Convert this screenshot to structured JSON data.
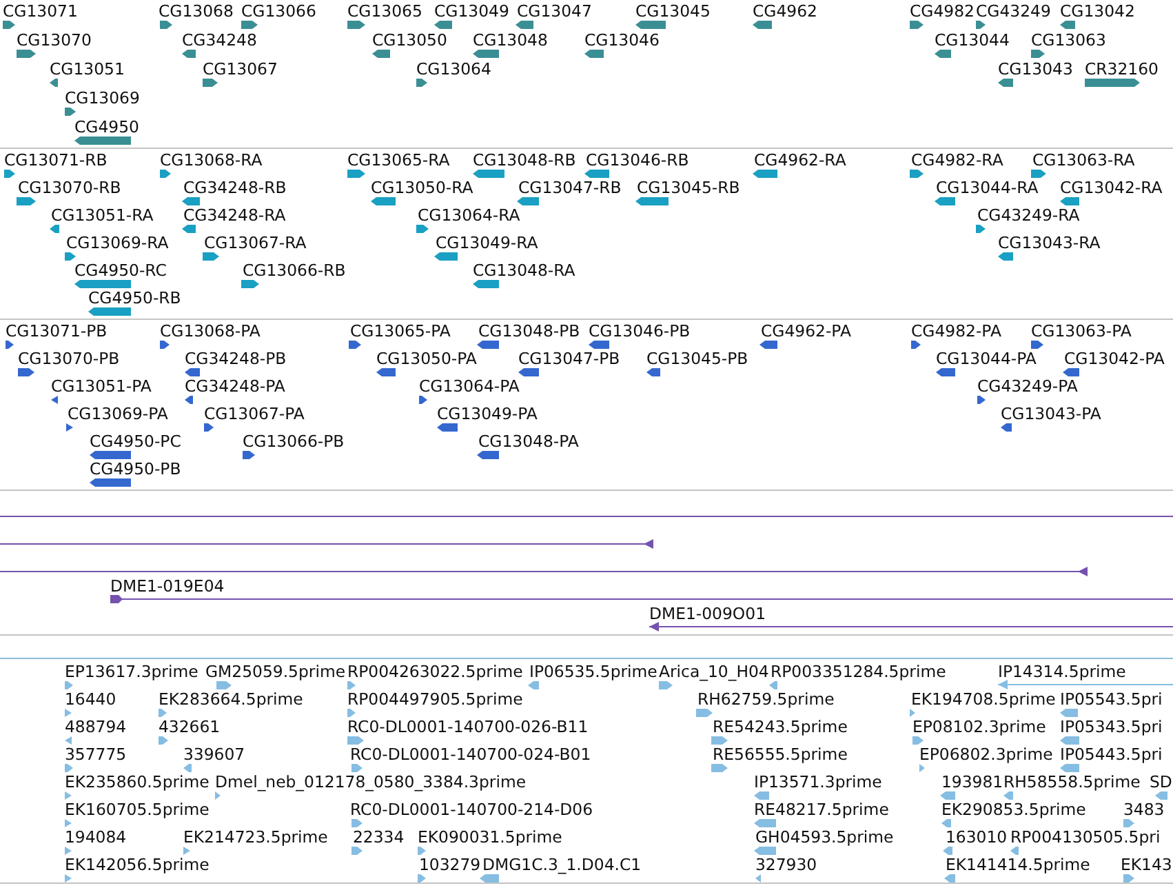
{
  "tracks": [
    {
      "kind": "arrows",
      "color": "#3a8f94",
      "lanes": [
        {
          "features": [
            {
              "label": "CG13071",
              "reverse": false
            },
            {
              "label": "CG13068",
              "reverse": false
            },
            {
              "label": "CG13066",
              "reverse": false
            },
            {
              "label": "CG13065",
              "reverse": false
            },
            {
              "label": "CG13049",
              "reverse": true
            },
            {
              "label": "CG13047",
              "reverse": true
            },
            {
              "label": "CG13045",
              "reverse": true
            },
            {
              "label": "CG4962",
              "reverse": true
            },
            {
              "label": "CG4982",
              "reverse": false
            },
            {
              "label": "CG43249",
              "reverse": false
            },
            {
              "label": "CG13042",
              "reverse": true
            }
          ]
        },
        {
          "features": [
            {
              "label": "CG13070",
              "reverse": false
            },
            {
              "label": "CG34248",
              "reverse": true
            },
            {
              "label": "CG13050",
              "reverse": true
            },
            {
              "label": "CG13048",
              "reverse": true
            },
            {
              "label": "CG13046",
              "reverse": true
            },
            {
              "label": "CG13044",
              "reverse": true
            },
            {
              "label": "CG13063",
              "reverse": false
            }
          ]
        },
        {
          "features": [
            {
              "label": "CG13051",
              "reverse": true
            },
            {
              "label": "CG13067",
              "reverse": false
            },
            {
              "label": "CG13064",
              "reverse": false
            },
            {
              "label": "CG13043",
              "reverse": true
            },
            {
              "label": "CR32160",
              "reverse": false
            }
          ]
        },
        {
          "features": [
            {
              "label": "CG13069",
              "reverse": false
            }
          ]
        },
        {
          "features": [
            {
              "label": "CG4950",
              "reverse": true
            }
          ]
        }
      ]
    },
    {
      "kind": "arrows",
      "color": "#19a0c2",
      "lanes": [
        {
          "features": [
            {
              "label": "CG13071-RB",
              "reverse": false
            },
            {
              "label": "CG13068-RA",
              "reverse": false
            },
            {
              "label": "CG13065-RA",
              "reverse": false
            },
            {
              "label": "CG13048-RB",
              "reverse": true
            },
            {
              "label": "CG13046-RB",
              "reverse": true
            },
            {
              "label": "CG4962-RA",
              "reverse": true
            },
            {
              "label": "CG4982-RA",
              "reverse": false
            },
            {
              "label": "CG13063-RA",
              "reverse": false
            }
          ]
        },
        {
          "features": [
            {
              "label": "CG13070-RB",
              "reverse": false
            },
            {
              "label": "CG34248-RB",
              "reverse": true
            },
            {
              "label": "CG13050-RA",
              "reverse": true
            },
            {
              "label": "CG13047-RB",
              "reverse": true
            },
            {
              "label": "CG13045-RB",
              "reverse": true
            },
            {
              "label": "CG13044-RA",
              "reverse": true
            },
            {
              "label": "CG13042-RA",
              "reverse": true
            }
          ]
        },
        {
          "features": [
            {
              "label": "CG13051-RA",
              "reverse": true
            },
            {
              "label": "CG34248-RA",
              "reverse": true
            },
            {
              "label": "CG13064-RA",
              "reverse": false
            },
            {
              "label": "CG43249-RA",
              "reverse": false
            }
          ]
        },
        {
          "features": [
            {
              "label": "CG13069-RA",
              "reverse": false
            },
            {
              "label": "CG13067-RA",
              "reverse": false
            },
            {
              "label": "CG13049-RA",
              "reverse": true
            },
            {
              "label": "CG13043-RA",
              "reverse": true
            }
          ]
        },
        {
          "features": [
            {
              "label": "CG4950-RC",
              "reverse": true
            },
            {
              "label": "CG13066-RB",
              "reverse": false
            },
            {
              "label": "CG13048-RA",
              "reverse": true
            }
          ]
        },
        {
          "features": [
            {
              "label": "CG4950-RB",
              "reverse": true
            }
          ]
        }
      ]
    },
    {
      "kind": "arrows",
      "color": "#3468cf",
      "lanes": [
        {
          "features": [
            {
              "label": "CG13071-PB",
              "reverse": false
            },
            {
              "label": "CG13068-PA",
              "reverse": false
            },
            {
              "label": "CG13065-PA",
              "reverse": false
            },
            {
              "label": "CG13048-PB",
              "reverse": true
            },
            {
              "label": "CG13046-PB",
              "reverse": true
            },
            {
              "label": "CG4962-PA",
              "reverse": true
            },
            {
              "label": "CG4982-PA",
              "reverse": false
            },
            {
              "label": "CG13063-PA",
              "reverse": false
            }
          ]
        },
        {
          "features": [
            {
              "label": "CG13070-PB",
              "reverse": false
            },
            {
              "label": "CG34248-PB",
              "reverse": true
            },
            {
              "label": "CG13050-PA",
              "reverse": true
            },
            {
              "label": "CG13047-PB",
              "reverse": true
            },
            {
              "label": "CG13045-PB",
              "reverse": true
            },
            {
              "label": "CG13044-PA",
              "reverse": true
            },
            {
              "label": "CG13042-PA",
              "reverse": true
            }
          ]
        },
        {
          "features": [
            {
              "label": "CG13051-PA",
              "reverse": true
            },
            {
              "label": "CG34248-PA",
              "reverse": true
            },
            {
              "label": "CG13064-PA",
              "reverse": false
            },
            {
              "label": "CG43249-PA",
              "reverse": false
            }
          ]
        },
        {
          "features": [
            {
              "label": "CG13069-PA",
              "reverse": false
            },
            {
              "label": "CG13067-PA",
              "reverse": false
            },
            {
              "label": "CG13049-PA",
              "reverse": true
            },
            {
              "label": "CG13043-PA",
              "reverse": true
            }
          ]
        },
        {
          "features": [
            {
              "label": "CG4950-PC",
              "reverse": true
            },
            {
              "label": "CG13066-PB",
              "reverse": false
            },
            {
              "label": "CG13048-PA",
              "reverse": true
            }
          ]
        },
        {
          "features": [
            {
              "label": "CG4950-PB",
              "reverse": true
            }
          ]
        }
      ]
    },
    {
      "kind": "lines",
      "color": "#7452ae",
      "lanes": [
        {
          "features": [
            {
              "kind": "line"
            }
          ]
        },
        {
          "features": [
            {
              "kind": "line",
              "reverse": true
            }
          ]
        },
        {
          "features": [
            {
              "kind": "line",
              "reverse": true
            }
          ]
        },
        {
          "features": [
            {
              "kind": "line",
              "label": "DME1-019E04",
              "reverse": false
            }
          ]
        },
        {
          "features": [
            {
              "kind": "line",
              "label": "DME1-009O01",
              "reverse": true
            }
          ]
        }
      ]
    },
    {
      "kind": "arrows",
      "color": "#86bde2",
      "lanes": [
        {
          "features": [
            {
              "label": "EP13617.3prime",
              "reverse": false
            },
            {
              "label": "GM25059.5prime",
              "reverse": false
            },
            {
              "label": "RP004263022.5prime",
              "reverse": false
            },
            {
              "label": "IP06535.5prime",
              "reverse": true
            },
            {
              "label": "Arica_10_H04",
              "reverse": false
            },
            {
              "label": "RP003351284.5prime",
              "reverse": true
            },
            {
              "label": "IP14314.5prime",
              "reverse": true
            }
          ]
        },
        {
          "features": [
            {
              "label": "16440",
              "reverse": false
            },
            {
              "label": "EK283664.5prime",
              "reverse": false
            },
            {
              "label": "RP004497905.5prime",
              "reverse": false
            },
            {
              "label": "RH62759.5prime",
              "reverse": false
            },
            {
              "label": "EK194708.5prime",
              "reverse": false
            },
            {
              "label": "IP05543.5pri",
              "reverse": true
            }
          ]
        },
        {
          "features": [
            {
              "label": "488794",
              "reverse": true
            },
            {
              "label": "432661",
              "reverse": false
            },
            {
              "label": "RC0-DL0001-140700-026-B11",
              "reverse": false
            },
            {
              "label": "RE54243.5prime",
              "reverse": false
            },
            {
              "label": "EP08102.3prime",
              "reverse": false
            },
            {
              "label": "IP05343.5pri",
              "reverse": true
            }
          ]
        },
        {
          "features": [
            {
              "label": "357775",
              "reverse": false
            },
            {
              "label": "339607",
              "reverse": true
            },
            {
              "label": "RC0-DL0001-140700-024-B01",
              "reverse": false
            },
            {
              "label": "RE56555.5prime",
              "reverse": false
            },
            {
              "label": "EP06802.3prime",
              "reverse": false
            },
            {
              "label": "IP05443.5pri",
              "reverse": true
            }
          ]
        },
        {
          "features": [
            {
              "label": "EK235860.5prime",
              "reverse": false
            },
            {
              "label": "Dmel_neb_012178_0580_3384.3prime",
              "reverse": false
            },
            {
              "label": "IP13571.3prime",
              "reverse": true
            },
            {
              "label": "193981",
              "reverse": true
            },
            {
              "label": "RH58558.5prime",
              "reverse": true
            },
            {
              "label": "SD",
              "reverse": true
            }
          ]
        },
        {
          "features": [
            {
              "label": "EK160705.5prime",
              "reverse": false
            },
            {
              "label": "RC0-DL0001-140700-214-D06",
              "reverse": false
            },
            {
              "label": "RE48217.5prime",
              "reverse": true
            },
            {
              "label": "EK290853.5prime",
              "reverse": true
            },
            {
              "label": "3483",
              "reverse": false
            }
          ]
        },
        {
          "features": [
            {
              "label": "194084",
              "reverse": false
            },
            {
              "label": "EK214723.5prime",
              "reverse": false
            },
            {
              "label": "22334",
              "reverse": false
            },
            {
              "label": "EK090031.5prime",
              "reverse": false
            },
            {
              "label": "GH04593.5prime",
              "reverse": true
            },
            {
              "label": "163010",
              "reverse": true
            },
            {
              "label": "RP004130505.5pri",
              "reverse": true
            }
          ]
        },
        {
          "features": [
            {
              "label": "EK142056.5prime",
              "reverse": false
            },
            {
              "label": "103279",
              "reverse": false
            },
            {
              "label": "DMG1C.3_1.D04.C1",
              "reverse": true
            },
            {
              "label": "327930",
              "reverse": true
            },
            {
              "label": "EK141414.5prime",
              "reverse": true
            },
            {
              "label": "EK143",
              "reverse": false
            }
          ]
        }
      ]
    }
  ]
}
